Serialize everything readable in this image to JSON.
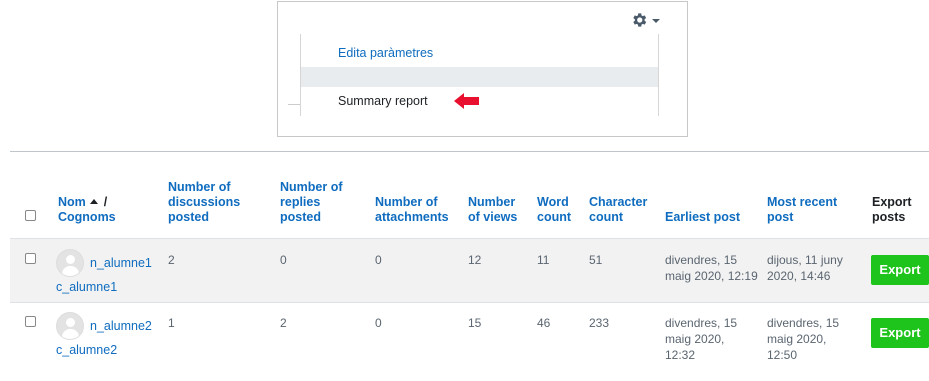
{
  "menu": {
    "edit_label": "Edita paràmetres",
    "summary_label": "Summary report"
  },
  "table": {
    "headers": {
      "name": "Nom",
      "name_sep": "/",
      "surname": "Cognoms",
      "discussions": [
        "Number of",
        "discussions",
        "posted"
      ],
      "replies": [
        "Number of",
        "replies",
        "posted"
      ],
      "attachments": [
        "Number of",
        "attachments"
      ],
      "views": [
        "Number",
        "of views"
      ],
      "words": [
        "Word",
        "count"
      ],
      "chars": [
        "Character",
        "count"
      ],
      "earliest": "Earliest post",
      "recent": [
        "Most recent",
        "post"
      ],
      "export": [
        "Export",
        "posts"
      ]
    },
    "rows": [
      {
        "first": "n_alumne1",
        "last": "c_alumne1",
        "discussions": "2",
        "replies": "0",
        "attachments": "0",
        "views": "12",
        "words": "11",
        "chars": "51",
        "earliest": [
          "divendres, 15",
          "maig 2020, 12:19"
        ],
        "recent": [
          "dijous, 11 juny",
          "2020, 14:46"
        ],
        "export": "Export"
      },
      {
        "first": "n_alumne2",
        "last": "c_alumne2",
        "discussions": "1",
        "replies": "2",
        "attachments": "0",
        "views": "15",
        "words": "46",
        "chars": "233",
        "earliest": [
          "divendres, 15",
          "maig 2020,",
          "12:32"
        ],
        "recent": [
          "divendres, 15",
          "maig 2020,",
          "12:50"
        ],
        "export": "Export"
      }
    ]
  },
  "colors": {
    "link": "#0f6cbf",
    "export_button": "#1ec41b",
    "arrow": "#e8102e",
    "row_highlight": "#f2f2f2"
  }
}
